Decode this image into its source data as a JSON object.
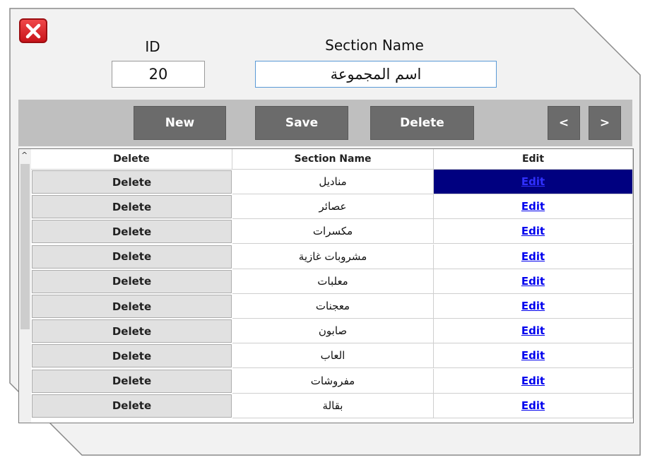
{
  "form": {
    "id_label": "ID",
    "id_value": "20",
    "section_name_label": "Section Name",
    "section_name_value": "اسم المجموعة"
  },
  "toolbar": {
    "new_label": "New",
    "save_label": "Save",
    "delete_label": "Delete",
    "prev_label": "<",
    "next_label": ">"
  },
  "grid": {
    "columns": [
      "Delete",
      "Section Name",
      "Edit"
    ],
    "scroll_up_glyph": "^",
    "selected_row": 0,
    "rows": [
      {
        "delete": "Delete",
        "name": "مناديل",
        "edit": "Edit"
      },
      {
        "delete": "Delete",
        "name": "عصائر",
        "edit": "Edit"
      },
      {
        "delete": "Delete",
        "name": "مكسرات",
        "edit": "Edit"
      },
      {
        "delete": "Delete",
        "name": "مشروبات غازية",
        "edit": "Edit"
      },
      {
        "delete": "Delete",
        "name": "معلبات",
        "edit": "Edit"
      },
      {
        "delete": "Delete",
        "name": "معجنات",
        "edit": "Edit"
      },
      {
        "delete": "Delete",
        "name": "صابون",
        "edit": "Edit"
      },
      {
        "delete": "Delete",
        "name": "العاب",
        "edit": "Edit"
      },
      {
        "delete": "Delete",
        "name": "مفروشات",
        "edit": "Edit"
      },
      {
        "delete": "Delete",
        "name": "بقالة",
        "edit": "Edit"
      }
    ]
  },
  "colors": {
    "toolbar_bg": "#bfbfbf",
    "button_bg": "#6b6b6b",
    "close_red": "#e0242a",
    "selection": "#000080",
    "link": "#0000ee"
  },
  "icons": {
    "close": "close-icon"
  }
}
